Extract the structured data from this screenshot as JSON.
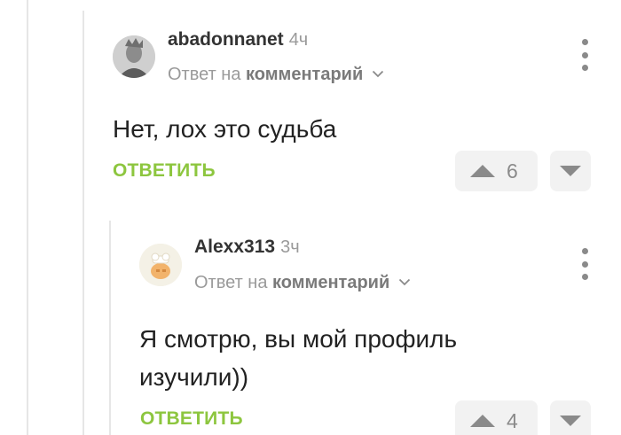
{
  "comments": [
    {
      "username": "abadonnanet",
      "time": "4ч",
      "reply_prefix": "Ответ на",
      "reply_link": "комментарий",
      "text": "Нет, лох это судьба",
      "reply_label": "ОТВЕТИТЬ",
      "rating": "6"
    },
    {
      "username": "Alexx313",
      "time": "3ч",
      "reply_prefix": "Ответ на",
      "reply_link": "комментарий",
      "text_lines": [
        "Я смотрю, вы мой профиль",
        "изучили))"
      ],
      "reply_label": "ОТВЕТИТЬ",
      "rating": "4"
    }
  ],
  "icons": {
    "more": "more-vertical-icon",
    "expand": "chevron-down-icon",
    "upvote": "arrow-up-icon",
    "downvote": "arrow-down-icon"
  },
  "colors": {
    "accent": "#8dc63f",
    "muted": "#9a9a9a",
    "vote_bg": "#f2f2f2"
  }
}
